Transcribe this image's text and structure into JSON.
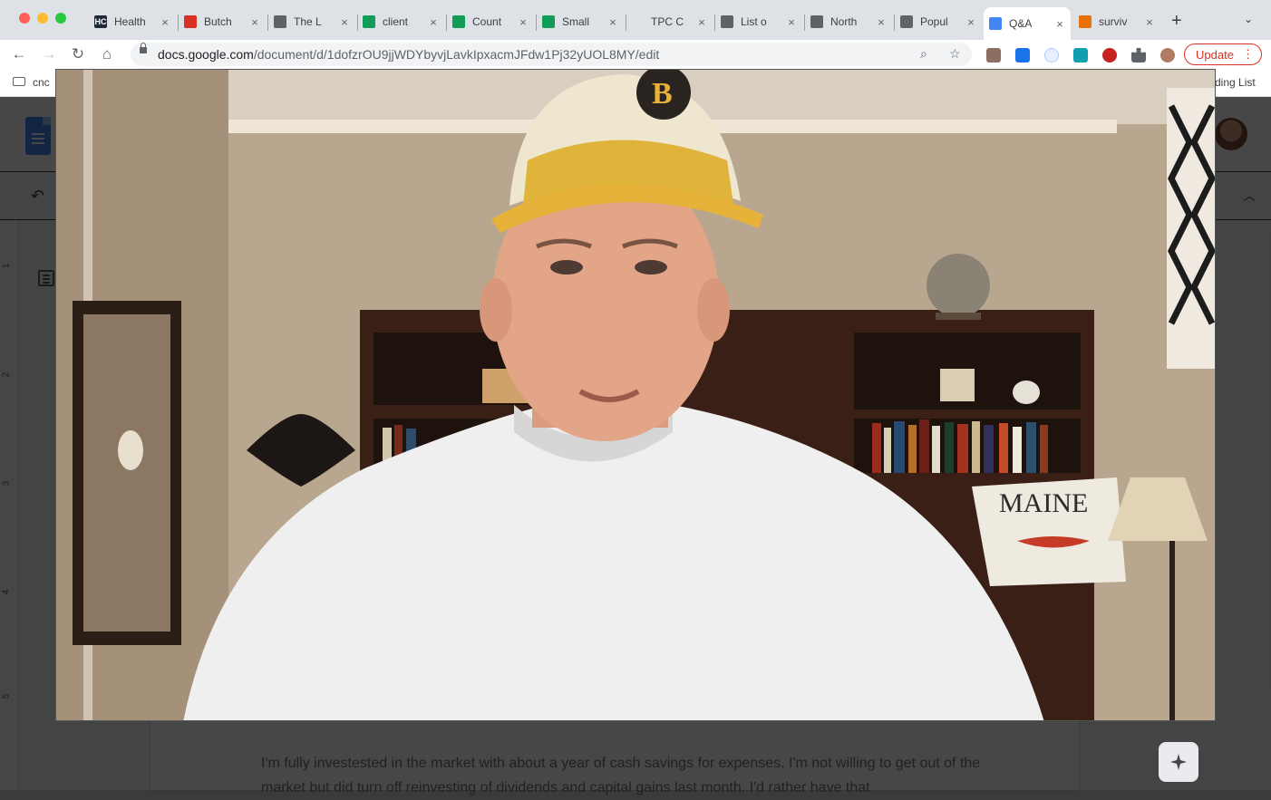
{
  "browser": {
    "tabs": [
      {
        "label": "Health",
        "icon": "hc-icon",
        "icon_text": "HC",
        "icon_color": "#1f2937"
      },
      {
        "label": "Butch",
        "icon": "pin-icon",
        "icon_text": "",
        "icon_color": "#d93025"
      },
      {
        "label": "The L",
        "icon": "globe-icon",
        "icon_text": "",
        "icon_color": "#5f6368"
      },
      {
        "label": "client",
        "icon": "sheets-icon",
        "icon_text": "",
        "icon_color": "#0f9d58"
      },
      {
        "label": "Count",
        "icon": "sheets-icon",
        "icon_text": "",
        "icon_color": "#0f9d58"
      },
      {
        "label": "Small",
        "icon": "sheets-icon",
        "icon_text": "",
        "icon_color": "#0f9d58"
      },
      {
        "label": "TPC C",
        "icon": "blank-icon",
        "icon_text": "",
        "icon_color": "#dee1e6"
      },
      {
        "label": "List o",
        "icon": "globe-icon",
        "icon_text": "",
        "icon_color": "#5f6368"
      },
      {
        "label": "North",
        "icon": "globe-icon",
        "icon_text": "",
        "icon_color": "#5f6368"
      },
      {
        "label": "Popul",
        "icon": "globe-icon",
        "icon_text": "",
        "icon_color": "#5f6368"
      },
      {
        "label": "Q&A",
        "icon": "docs-icon",
        "icon_text": "",
        "icon_color": "#4285f4",
        "active": true
      },
      {
        "label": "surviv",
        "icon": "survey-icon",
        "icon_text": "",
        "icon_color": "#e8710a"
      }
    ],
    "close_glyph": "×",
    "new_tab_glyph": "+",
    "tab_menu_glyph": "⌄",
    "url_host": "docs.google.com",
    "url_path": "/document/d/1dofzrOU9jjWDYbyvjLavkIpxacmJFdw1Pj32yUOL8MY/edit",
    "update_label": "Update",
    "update_dots": "⋮",
    "bookmark_left": "cnc",
    "bookmark_right": "ding List"
  },
  "colors": {
    "accent_red": "#d93025",
    "docs_blue": "#4285f4"
  },
  "docs": {
    "ruler_numbers": [
      "1",
      "2",
      "3",
      "4",
      "5"
    ],
    "body_text": "I'm fully investested in the market with about a year of cash savings for expenses. I'm not willing to get out of the market but did turn off reinvesting of dividends and capital gains last month. I'd rather have that",
    "undo_glyph": "↶",
    "collapse_glyph": "︿",
    "side_chevron_glyph": "‹"
  },
  "video": {
    "pillow_text": "MAINE",
    "cap_letter": "B"
  }
}
